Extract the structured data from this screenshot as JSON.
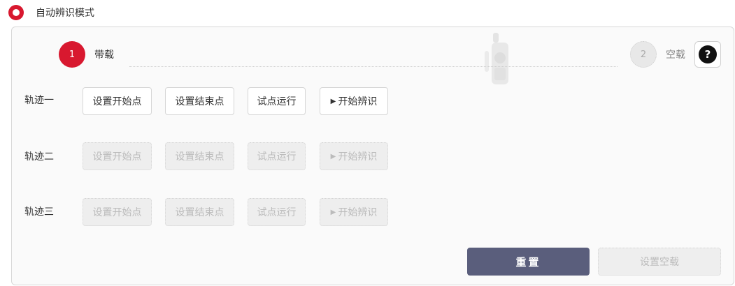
{
  "mode": {
    "label": "自动辨识模式"
  },
  "steps": [
    {
      "number": "1",
      "label": "带载"
    },
    {
      "number": "2",
      "label": "空载"
    }
  ],
  "help": {
    "glyph": "?"
  },
  "tracks": [
    {
      "label": "轨迹一",
      "buttons": [
        "设置开始点",
        "设置结束点",
        "试点运行",
        "开始辨识"
      ]
    },
    {
      "label": "轨迹二",
      "buttons": [
        "设置开始点",
        "设置结束点",
        "试点运行",
        "开始辨识"
      ]
    },
    {
      "label": "轨迹三",
      "buttons": [
        "设置开始点",
        "设置结束点",
        "试点运行",
        "开始辨识"
      ]
    }
  ],
  "footer": {
    "reset_label": "重置",
    "set_empty_label": "设置空载"
  },
  "colors": {
    "accent": "#d8182f",
    "primary_button": "#5a5e7c",
    "disabled_bg": "#eeeeee",
    "disabled_text": "#bbbbbb"
  }
}
